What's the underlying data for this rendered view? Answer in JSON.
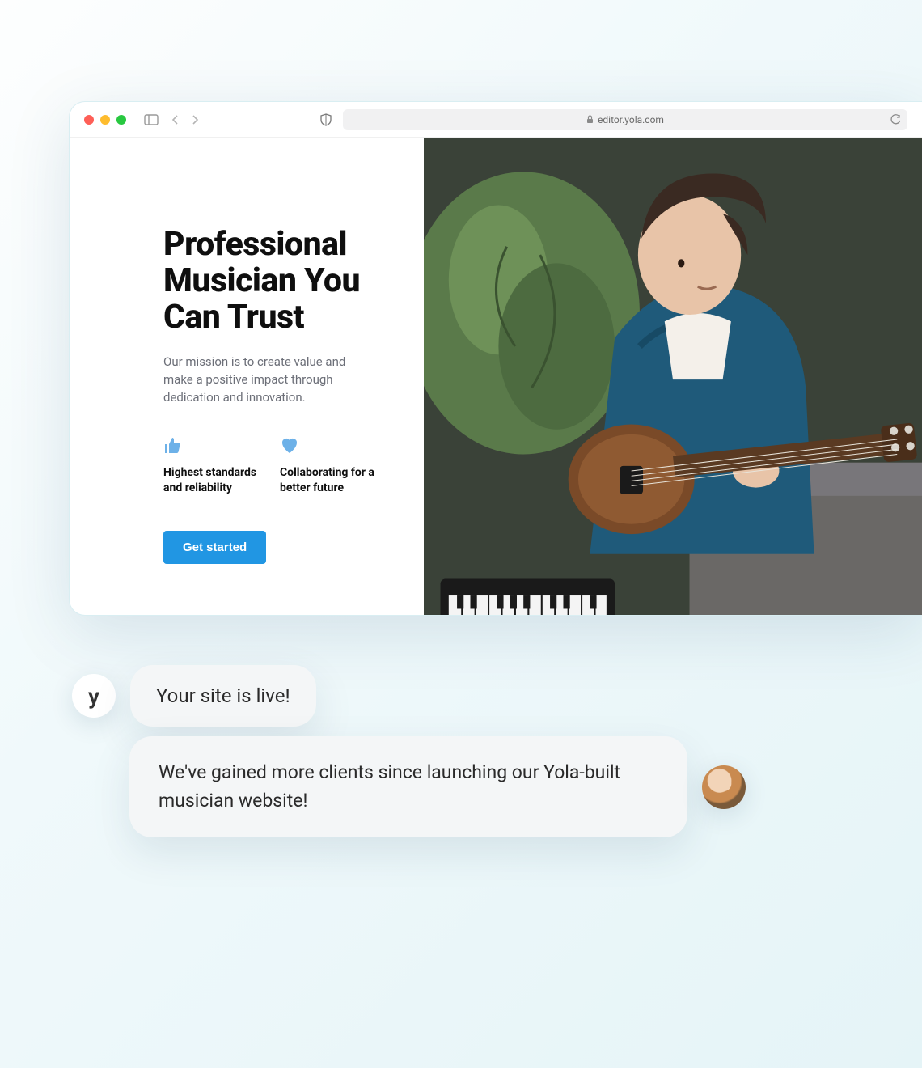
{
  "browser": {
    "url": "editor.yola.com"
  },
  "hero": {
    "headline": "Professional Musician You Can Trust",
    "mission": "Our mission is to create value and make a positive impact through dedication and innovation.",
    "features": [
      {
        "label": "Highest standards and reliability"
      },
      {
        "label": "Collaborating for a better future"
      }
    ],
    "cta": "Get started"
  },
  "chat": {
    "system_avatar": "y",
    "system_msg": "Your site is live!",
    "user_msg": "We've gained more clients since launching our Yola-built musician website!"
  }
}
